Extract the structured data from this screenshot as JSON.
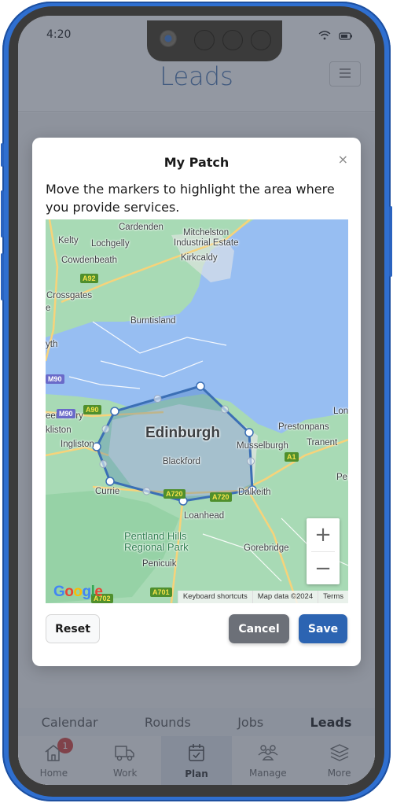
{
  "status_bar": {
    "time": "4:20",
    "wifi_icon": "wifi-icon",
    "battery_icon": "battery-icon"
  },
  "header": {
    "title": "Leads",
    "menu_icon": "hamburger-menu-icon"
  },
  "modal": {
    "title": "My Patch",
    "close_label": "×",
    "description": "Move the markers to highlight the area where you provide services.",
    "map": {
      "labels": {
        "cardenden": "Cardenden",
        "mitchelston": "Mitchelston",
        "industrial_estate": "Industrial Estate",
        "kelty": "Kelty",
        "lochgelly": "Lochgelly",
        "cowdenbeath": "Cowdenbeath",
        "kirkcaldy": "Kirkcaldy",
        "crossgates": "Crossgates",
        "burntisland": "Burntisland",
        "rosyth": "yth",
        "queensferry": "eensferry",
        "kirkliston": "kliston",
        "ingliston": "Ingliston",
        "edinburgh": "Edinburgh",
        "blackford": "Blackford",
        "musselburgh": "Musselburgh",
        "prestonpans": "Prestonpans",
        "tranent": "Tranent",
        "longniddry": "Lon",
        "pencaitland": "Pen",
        "currie": "Currie",
        "dalkeith": "Dalkeith",
        "loanhead": "Loanhead",
        "pentland_line1": "Pentland Hills",
        "pentland_line2": "Regional Park",
        "penicuik": "Penicuik",
        "gorebridge": "Gorebridge",
        "e_edge": "e"
      },
      "road_shields": {
        "a92": "A92",
        "a90": "A90",
        "m90_top": "M90",
        "m90": "M90",
        "a1": "A1",
        "a720_left": "A720",
        "a720_right": "A720",
        "a701": "A701",
        "a702": "A702"
      },
      "zoom_in_label": "+",
      "zoom_out_label": "−",
      "google_logo": "Google",
      "attribution": {
        "keyboard_shortcuts": "Keyboard shortcuts",
        "map_data": "Map data ©2024",
        "terms": "Terms"
      },
      "polygon_color": "#3b6fb5",
      "polygon_vertex_count": 8
    },
    "buttons": {
      "reset": "Reset",
      "cancel": "Cancel",
      "save": "Save"
    }
  },
  "sub_tabs": [
    {
      "label": "Calendar",
      "active": false
    },
    {
      "label": "Rounds",
      "active": false
    },
    {
      "label": "Jobs",
      "active": false
    },
    {
      "label": "Leads",
      "active": true
    }
  ],
  "bottom_nav": [
    {
      "label": "Home",
      "icon": "home-icon",
      "badge": "1",
      "active": false
    },
    {
      "label": "Work",
      "icon": "truck-icon",
      "active": false
    },
    {
      "label": "Plan",
      "icon": "calendar-check-icon",
      "active": true
    },
    {
      "label": "Manage",
      "icon": "people-icon",
      "active": false
    },
    {
      "label": "More",
      "icon": "layers-icon",
      "active": false
    }
  ],
  "colors": {
    "primary": "#2c64b2",
    "secondary": "#6c7078",
    "title_accent": "#5b83b8",
    "badge": "#d9534f",
    "phone_frame": "#2f6fd0"
  }
}
